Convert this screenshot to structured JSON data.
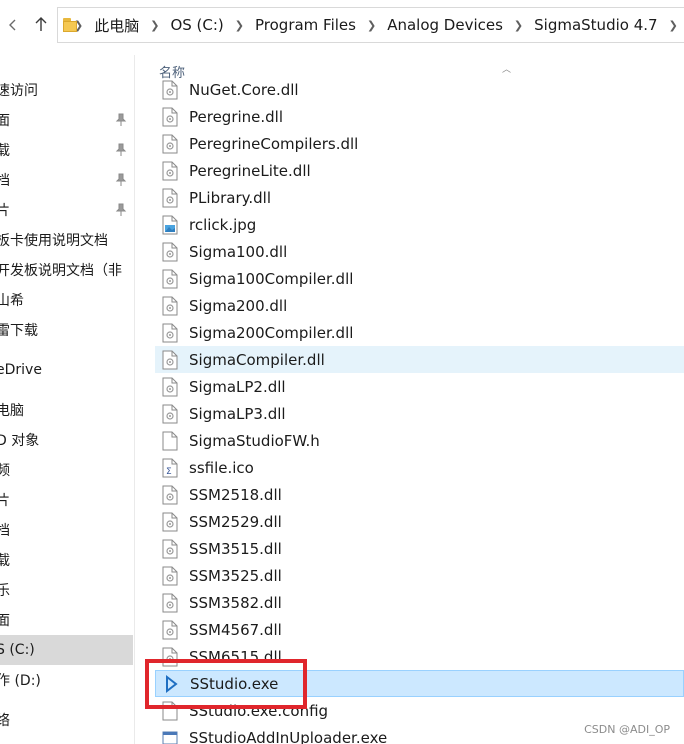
{
  "address_bar": {
    "crumbs": [
      "此电脑",
      "OS (C:)",
      "Program Files",
      "Analog Devices",
      "SigmaStudio 4.7"
    ],
    "back_icon": "arrow-left-icon",
    "up_icon": "arrow-up-icon"
  },
  "nav_pane": {
    "items": [
      {
        "label": "速访问",
        "pinned": false
      },
      {
        "label": "面",
        "pinned": true
      },
      {
        "label": "载",
        "pinned": true
      },
      {
        "label": "档",
        "pinned": true
      },
      {
        "label": "片",
        "pinned": true
      },
      {
        "label": "板卡使用说明文档",
        "pinned": false
      },
      {
        "label": "开发板说明文档（非",
        "pinned": false
      },
      {
        "label": "山希",
        "pinned": false
      },
      {
        "label": "雷下载",
        "pinned": false
      },
      {
        "label": "eDrive",
        "pinned": false
      },
      {
        "label": "电脑",
        "pinned": false
      },
      {
        "label": "D 对象",
        "pinned": false
      },
      {
        "label": "频",
        "pinned": false
      },
      {
        "label": "片",
        "pinned": false
      },
      {
        "label": "档",
        "pinned": false
      },
      {
        "label": "载",
        "pinned": false
      },
      {
        "label": "乐",
        "pinned": false
      },
      {
        "label": "面",
        "pinned": false
      },
      {
        "label": "S (C:)",
        "pinned": false
      },
      {
        "label": "作 (D:)",
        "pinned": false
      },
      {
        "label": "络",
        "pinned": false
      }
    ]
  },
  "file_list": {
    "column_name": "名称",
    "files": [
      {
        "name": "NuGet.Core.dll",
        "icon": "dll-file-icon"
      },
      {
        "name": "Peregrine.dll",
        "icon": "dll-file-icon"
      },
      {
        "name": "PeregrineCompilers.dll",
        "icon": "dll-file-icon"
      },
      {
        "name": "PeregrineLite.dll",
        "icon": "dll-file-icon"
      },
      {
        "name": "PLibrary.dll",
        "icon": "dll-file-icon"
      },
      {
        "name": "rclick.jpg",
        "icon": "image-file-icon"
      },
      {
        "name": "Sigma100.dll",
        "icon": "dll-file-icon"
      },
      {
        "name": "Sigma100Compiler.dll",
        "icon": "dll-file-icon"
      },
      {
        "name": "Sigma200.dll",
        "icon": "dll-file-icon"
      },
      {
        "name": "Sigma200Compiler.dll",
        "icon": "dll-file-icon"
      },
      {
        "name": "SigmaCompiler.dll",
        "icon": "dll-file-icon"
      },
      {
        "name": "SigmaLP2.dll",
        "icon": "dll-file-icon"
      },
      {
        "name": "SigmaLP3.dll",
        "icon": "dll-file-icon"
      },
      {
        "name": "SigmaStudioFW.h",
        "icon": "blank-file-icon"
      },
      {
        "name": "ssfile.ico",
        "icon": "ico-file-icon"
      },
      {
        "name": "SSM2518.dll",
        "icon": "dll-file-icon"
      },
      {
        "name": "SSM2529.dll",
        "icon": "dll-file-icon"
      },
      {
        "name": "SSM3515.dll",
        "icon": "dll-file-icon"
      },
      {
        "name": "SSM3525.dll",
        "icon": "dll-file-icon"
      },
      {
        "name": "SSM3582.dll",
        "icon": "dll-file-icon"
      },
      {
        "name": "SSM4567.dll",
        "icon": "dll-file-icon"
      },
      {
        "name": "SSM6515.dll",
        "icon": "dll-file-icon"
      },
      {
        "name": "SStudio.exe",
        "icon": "exe-app-icon"
      },
      {
        "name": "SStudio.exe.config",
        "icon": "blank-file-icon"
      },
      {
        "name": "SStudioAddInUploader.exe",
        "icon": "exe-window-icon"
      }
    ]
  },
  "watermark": "CSDN @ADI_OP",
  "colors": {
    "highlight": "#e0262c",
    "selection": "#cce8ff",
    "hover": "#e5f3fb"
  }
}
